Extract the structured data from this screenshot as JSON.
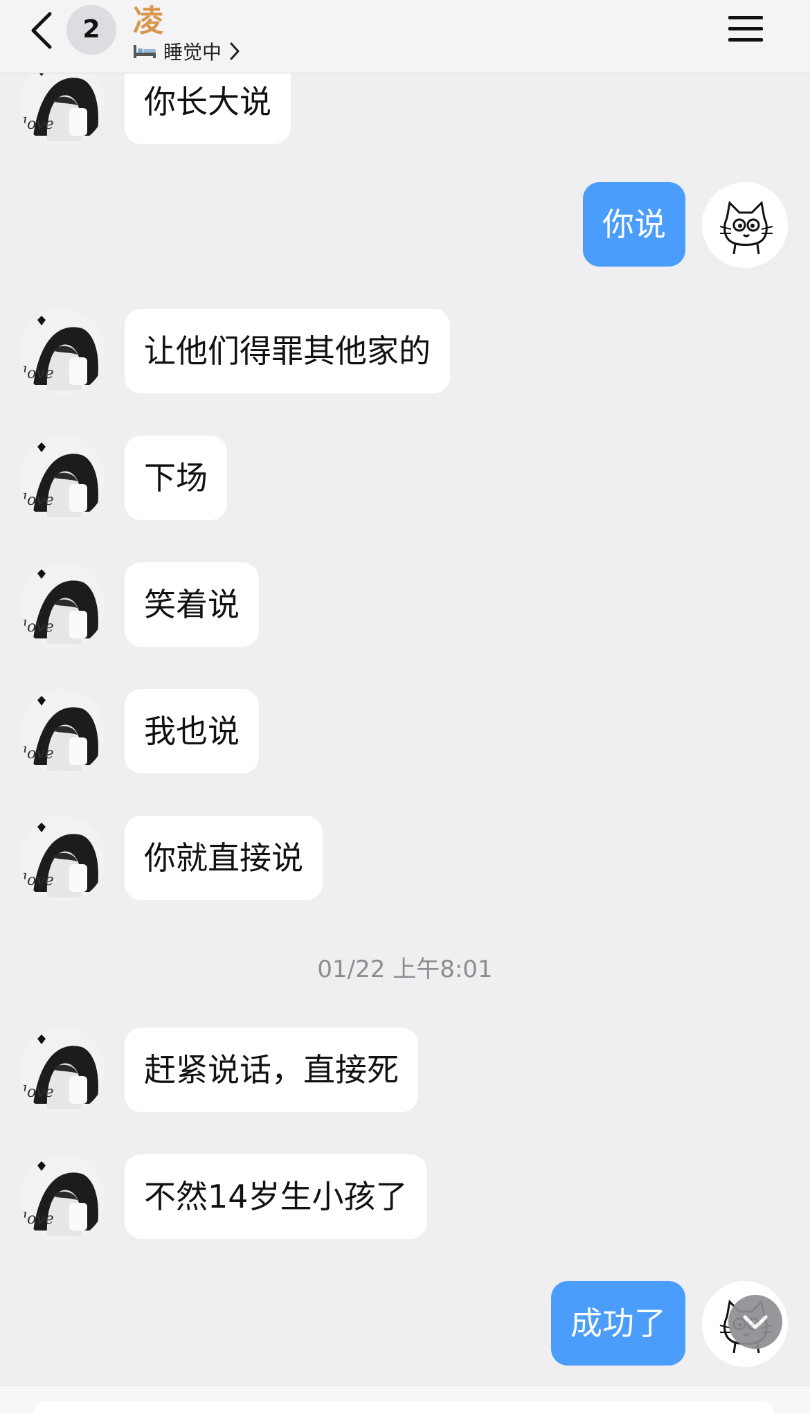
{
  "header": {
    "badge_count": "2",
    "contact_name": "凌",
    "status_text": "睡觉中"
  },
  "messages": [
    {
      "side": "in",
      "text": "你长大说"
    },
    {
      "side": "out",
      "text": "你说"
    },
    {
      "side": "in",
      "text": "让他们得罪其他家的"
    },
    {
      "side": "in",
      "text": "下场"
    },
    {
      "side": "in",
      "text": "笑着说"
    },
    {
      "side": "in",
      "text": "我也说"
    },
    {
      "side": "in",
      "text": "你就直接说"
    },
    {
      "side": "in",
      "text": "赶紧说话，直接死"
    },
    {
      "side": "in",
      "text": "不然14岁生小孩了"
    },
    {
      "side": "out",
      "text": "成功了"
    }
  ],
  "timestamp": "01/22 上午8:01",
  "icons": {
    "back": "chevron-left-icon",
    "menu": "hamburger-menu-icon",
    "status": "bed-icon",
    "status_more": "chevron-right-icon",
    "scroll": "chevron-down-icon"
  },
  "colors": {
    "outgoing_bubble": "#4a9dfb",
    "incoming_bubble": "#ffffff",
    "background": "#efeff1",
    "contact_name": "#d8974c"
  }
}
